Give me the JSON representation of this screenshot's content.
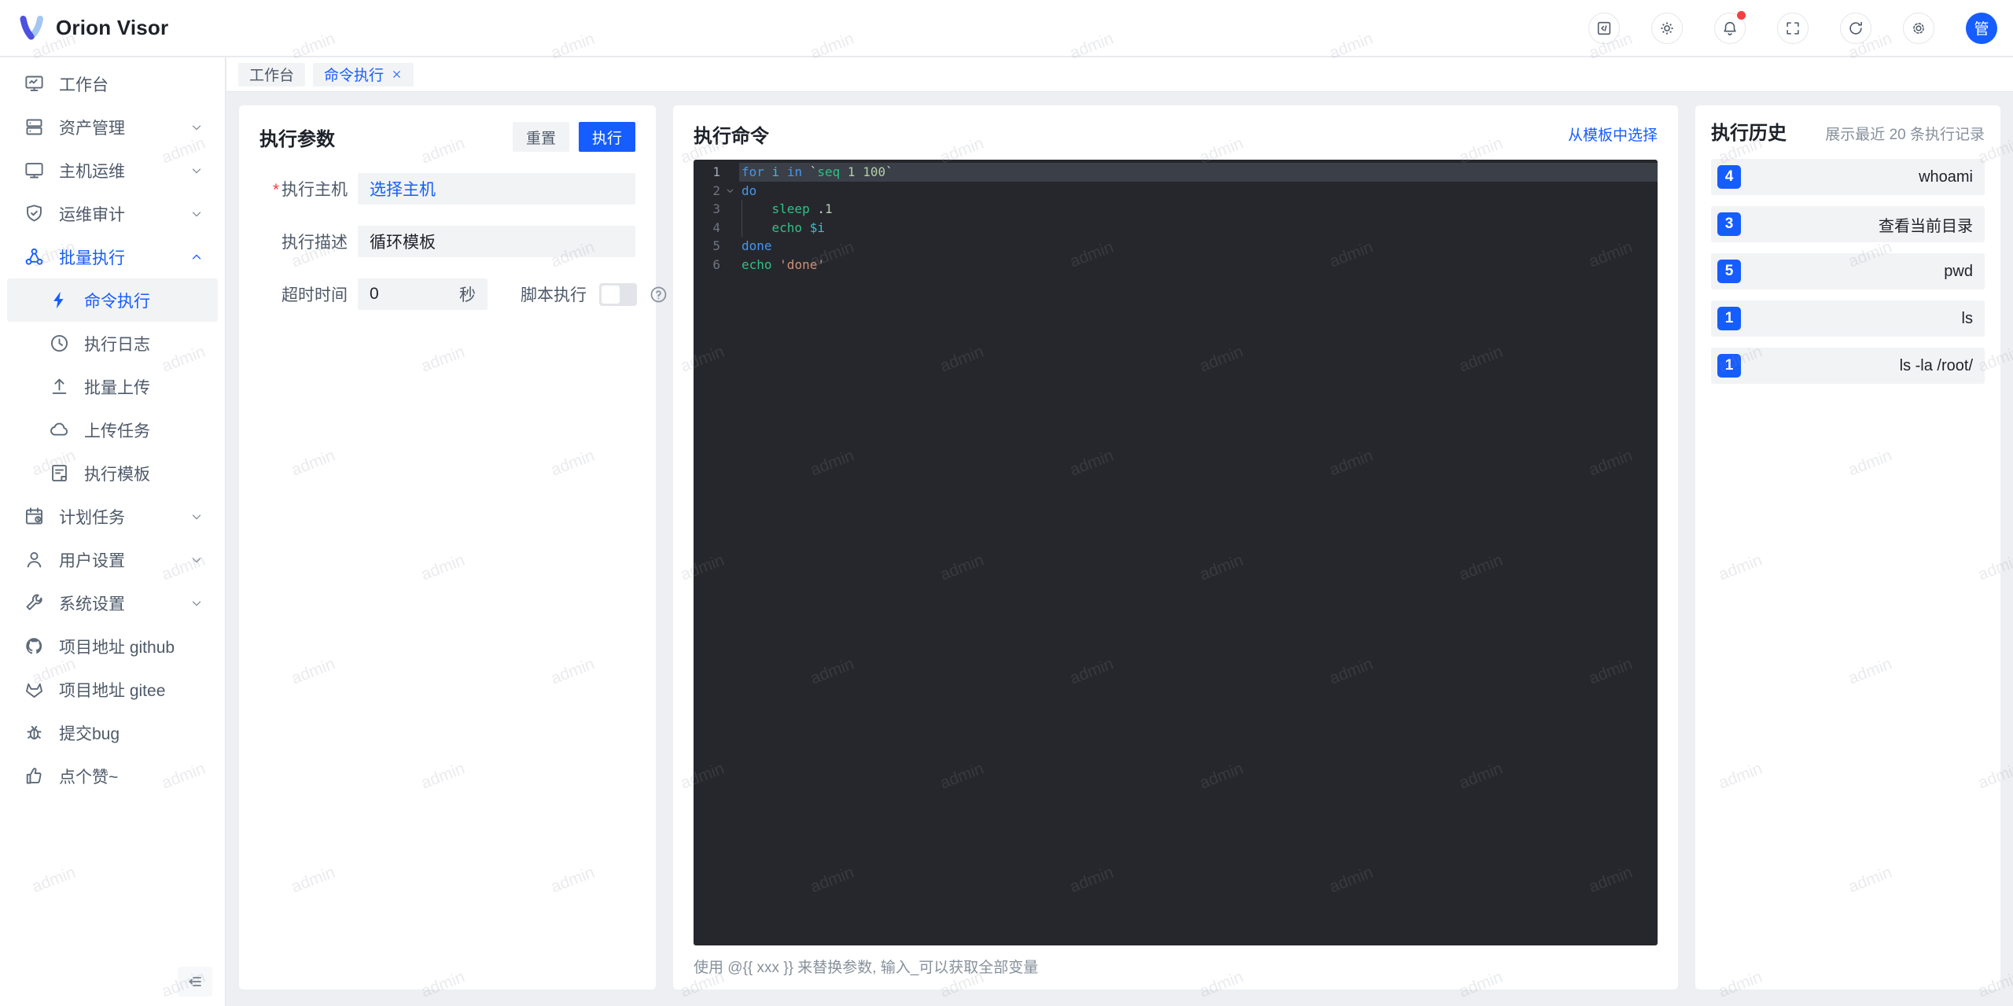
{
  "app": {
    "name": "Orion Visor",
    "avatar_text": "管"
  },
  "colors": {
    "accent": "#165dff",
    "danger": "#f53f3f",
    "editor_background": "#26272c",
    "code_keyword": "#4696ec",
    "code_command": "#2ec186",
    "code_variable": "#38bfcd",
    "code_number": "#b5cea8",
    "code_string": "#ce9178"
  },
  "header": {
    "actions": [
      {
        "id": "api-docs",
        "icon": "code-square-icon",
        "badge": false
      },
      {
        "id": "theme",
        "icon": "theme-icon",
        "badge": false
      },
      {
        "id": "notifications",
        "icon": "bell-icon",
        "badge": true
      },
      {
        "id": "fullscreen",
        "icon": "fullscreen-icon",
        "badge": false
      },
      {
        "id": "refresh",
        "icon": "refresh-icon",
        "badge": false
      },
      {
        "id": "settings",
        "icon": "gear-icon",
        "badge": false
      }
    ]
  },
  "sidebar": {
    "items": [
      {
        "id": "workbench",
        "label": "工作台",
        "icon": "dashboard-icon"
      },
      {
        "id": "assets",
        "label": "资产管理",
        "icon": "server-icon",
        "chevron": "down"
      },
      {
        "id": "host-ops",
        "label": "主机运维",
        "icon": "monitor-icon",
        "chevron": "down"
      },
      {
        "id": "audit",
        "label": "运维审计",
        "icon": "shield-icon",
        "chevron": "down"
      },
      {
        "id": "batch-exec",
        "label": "批量执行",
        "icon": "nodes-icon",
        "chevron": "up",
        "active": true
      },
      {
        "id": "command-exec",
        "label": "命令执行",
        "icon": "lightning-icon",
        "sub": true,
        "selected": true
      },
      {
        "id": "exec-log",
        "label": "执行日志",
        "icon": "clock-icon",
        "sub": true
      },
      {
        "id": "batch-upload",
        "label": "批量上传",
        "icon": "upload-icon",
        "sub": true
      },
      {
        "id": "upload-tasks",
        "label": "上传任务",
        "icon": "cloud-icon",
        "sub": true
      },
      {
        "id": "exec-template",
        "label": "执行模板",
        "icon": "template-icon",
        "sub": true
      },
      {
        "id": "schedule",
        "label": "计划任务",
        "icon": "calendar-icon",
        "chevron": "down"
      },
      {
        "id": "user-settings",
        "label": "用户设置",
        "icon": "user-icon",
        "chevron": "down"
      },
      {
        "id": "system-settings",
        "label": "系统设置",
        "icon": "wrench-icon",
        "chevron": "down"
      },
      {
        "id": "github",
        "label": "项目地址 github",
        "icon": "github-icon"
      },
      {
        "id": "gitee",
        "label": "项目地址 gitee",
        "icon": "gitee-icon"
      },
      {
        "id": "bug",
        "label": "提交bug",
        "icon": "bug-icon"
      },
      {
        "id": "like",
        "label": "点个赞~",
        "icon": "thumbs-up-icon"
      }
    ]
  },
  "tabs": [
    {
      "label": "工作台",
      "active": false,
      "closable": false
    },
    {
      "label": "命令执行",
      "active": true,
      "closable": true
    }
  ],
  "params": {
    "title": "执行参数",
    "reset": "重置",
    "run": "执行",
    "required_mark": "*",
    "host_label": "执行主机",
    "host_value": "选择主机",
    "desc_label": "执行描述",
    "desc_value": "循环模板",
    "timeout_label": "超时时间",
    "timeout_value": "0",
    "timeout_unit": "秒",
    "script_label": "脚本执行",
    "script_enabled": false
  },
  "command": {
    "title": "执行命令",
    "template_link": "从模板中选择",
    "hint": "使用 @{{ xxx }} 来替换参数, 输入_可以获取全部变量",
    "lines": [
      {
        "n": 1,
        "active": true,
        "tokens": [
          [
            "kw",
            "for"
          ],
          [
            "pl",
            " "
          ],
          [
            "var",
            "i"
          ],
          [
            "pl",
            " "
          ],
          [
            "kw",
            "in"
          ],
          [
            "pl",
            " "
          ],
          [
            "pun",
            "`"
          ],
          [
            "cmd",
            "seq"
          ],
          [
            "pl",
            " "
          ],
          [
            "num",
            "1"
          ],
          [
            "pl",
            " "
          ],
          [
            "num",
            "100"
          ],
          [
            "pun",
            "`"
          ]
        ]
      },
      {
        "n": 2,
        "fold": true,
        "tokens": [
          [
            "kw",
            "do"
          ]
        ]
      },
      {
        "n": 3,
        "guide": true,
        "tokens": [
          [
            "pl",
            "    "
          ],
          [
            "cmd",
            "sleep"
          ],
          [
            "pl",
            " "
          ],
          [
            "pun",
            "."
          ],
          [
            "num",
            "1"
          ]
        ]
      },
      {
        "n": 4,
        "guide": true,
        "tokens": [
          [
            "pl",
            "    "
          ],
          [
            "cmd",
            "echo"
          ],
          [
            "pl",
            " "
          ],
          [
            "var",
            "$i"
          ]
        ]
      },
      {
        "n": 5,
        "tokens": [
          [
            "kw",
            "done"
          ]
        ]
      },
      {
        "n": 6,
        "tokens": [
          [
            "cmd",
            "echo"
          ],
          [
            "pl",
            " "
          ],
          [
            "str",
            "'done'"
          ]
        ]
      }
    ]
  },
  "history": {
    "title": "执行历史",
    "subtitle": "展示最近 20 条执行记录",
    "items": [
      {
        "count": "4",
        "command": "whoami"
      },
      {
        "count": "3",
        "command": "查看当前目录"
      },
      {
        "count": "5",
        "command": "pwd"
      },
      {
        "count": "1",
        "command": "ls"
      },
      {
        "count": "1",
        "command": "ls -la /root/"
      }
    ]
  },
  "watermark": {
    "text": "admin"
  }
}
